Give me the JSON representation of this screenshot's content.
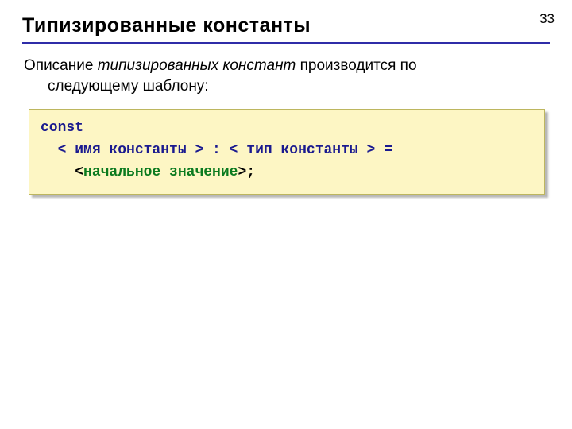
{
  "page_number": "33",
  "title": "Типизированные  константы",
  "intro": {
    "line1_pre": "Описание ",
    "line1_em": "типизированных констант",
    "line1_post": " производится по",
    "line2": "следующему шаблону:"
  },
  "code": {
    "l1_const": "const",
    "l2_lt1": "  < ",
    "l2_name": "имя константы",
    "l2_gt_colon_lt": " > : < ",
    "l2_type": "тип константы",
    "l2_gt_eq": " > =",
    "l3_lt": "    <",
    "l3_val": "начальное значение",
    "l3_gt_semi": ">;"
  }
}
